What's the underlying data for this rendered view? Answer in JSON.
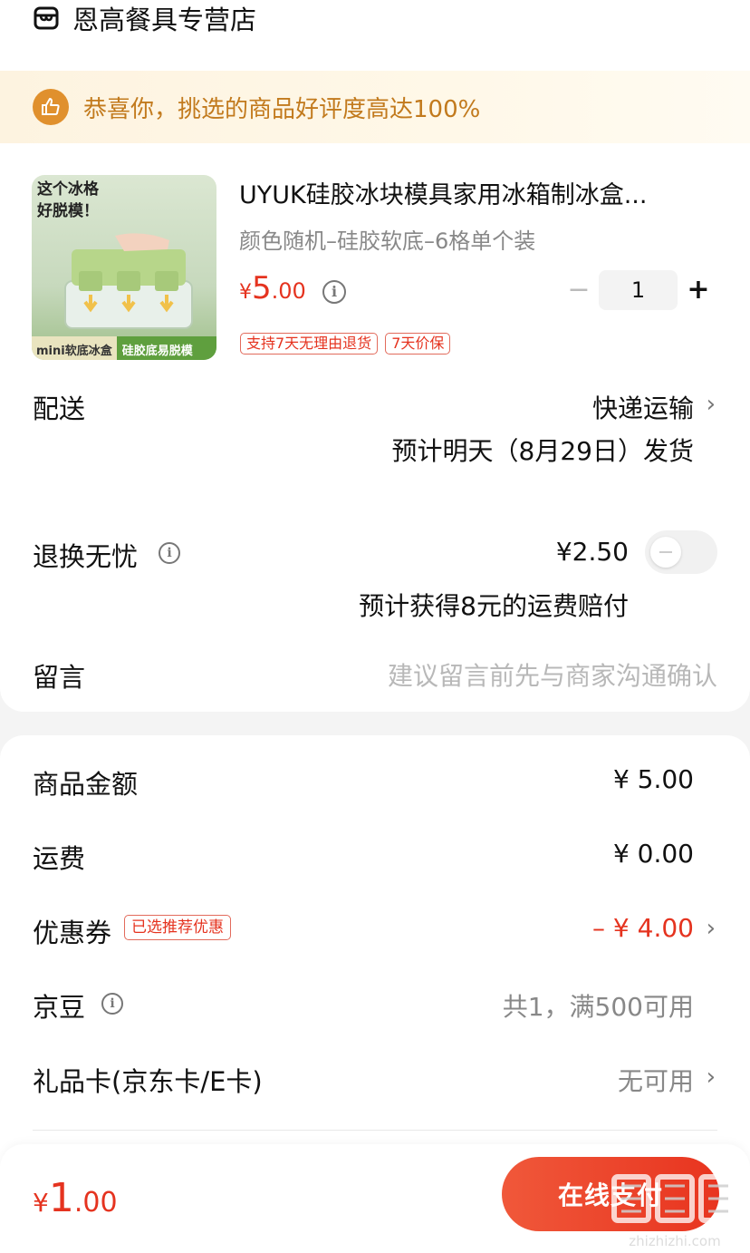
{
  "store": {
    "name": "恩高餐具专营店"
  },
  "banner": {
    "text": "恭喜你，挑选的商品好评度高达100%"
  },
  "product": {
    "image_caption_top": "这个冰格\n好脱模！",
    "image_caption_left": "mini软底冰盒",
    "image_caption_right": "硅胶底易脱模",
    "title": "UYUK硅胶冰块模具家用冰箱制冰盒...",
    "spec": "颜色随机–硅胶软底–6格单个装",
    "price_yen": "¥",
    "price_int": "5",
    "price_dec": ".00",
    "quantity": "1",
    "minus_label": "−",
    "plus_label": "+",
    "tags": [
      "支持7天无理由退货",
      "7天价保"
    ]
  },
  "delivery": {
    "label": "配送",
    "method": "快递运输",
    "time": "预计明天（8月29日）发货"
  },
  "returns": {
    "label": "退换无忧",
    "price": "¥2.50",
    "note": "预计获得8元的运费赔付",
    "enabled": false
  },
  "message": {
    "label": "留言",
    "placeholder": "建议留言前先与商家沟通确认"
  },
  "summary": {
    "goods_label": "商品金额",
    "goods_value": "¥ 5.00",
    "shipping_label": "运费",
    "shipping_value": "¥ 0.00",
    "coupon_label": "优惠券",
    "coupon_tag": "已选推荐优惠",
    "coupon_value": "– ¥ 4.00",
    "jingdou_label": "京豆",
    "jingdou_value": "共1，满500可用",
    "giftcard_label": "礼品卡(京东卡/E卡)",
    "giftcard_value": "无可用"
  },
  "footer": {
    "total_yen": "¥",
    "total_int": "1",
    "total_dec": ".00",
    "pay_label": "在线支付"
  },
  "watermark": {
    "text": "zhizhizhi.com"
  },
  "colors": {
    "accent": "#e5331f",
    "banner_text": "#c27a1d",
    "badge": "#e0902d"
  },
  "icons": [
    "store-icon",
    "thumbs-up-icon",
    "info-icon",
    "chevron-right-icon"
  ]
}
